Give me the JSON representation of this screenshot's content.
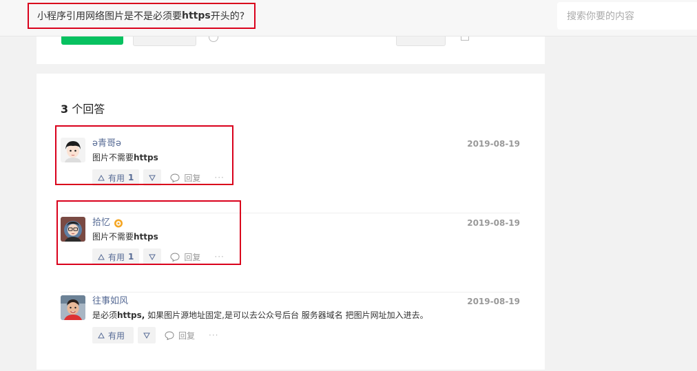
{
  "header": {
    "question_title_prefix": "小程序引用网络图片是不是必须要",
    "question_title_bold": "https",
    "question_title_suffix": "开头的?",
    "search_placeholder": "搜索你要的内容"
  },
  "answers_section": {
    "count": "3",
    "count_label": "个回答"
  },
  "answers": [
    {
      "author": "ə青哥ə",
      "date": "2019-08-19",
      "text_prefix": "图片不需要",
      "text_bold": "https",
      "text_suffix": "",
      "useful_label": "有用",
      "useful_count": "1",
      "reply_label": "回复",
      "more_label": "···"
    },
    {
      "author": "拾忆",
      "date": "2019-08-19",
      "text_prefix": "图片不需要",
      "text_bold": "https",
      "text_suffix": "",
      "useful_label": "有用",
      "useful_count": "1",
      "reply_label": "回复",
      "more_label": "···"
    },
    {
      "author": "往事如风",
      "date": "2019-08-19",
      "text_prefix": "是必须",
      "text_bold": "https,",
      "text_suffix": " 如果图片源地址固定,是可以去公众号后台 服务器域名 把图片网址加入进去。",
      "useful_label": "有用",
      "useful_count": "",
      "reply_label": "回复",
      "more_label": "···"
    }
  ],
  "colors": {
    "highlight": "#d9001b",
    "link": "#576b95",
    "badge": "#f5a623"
  }
}
